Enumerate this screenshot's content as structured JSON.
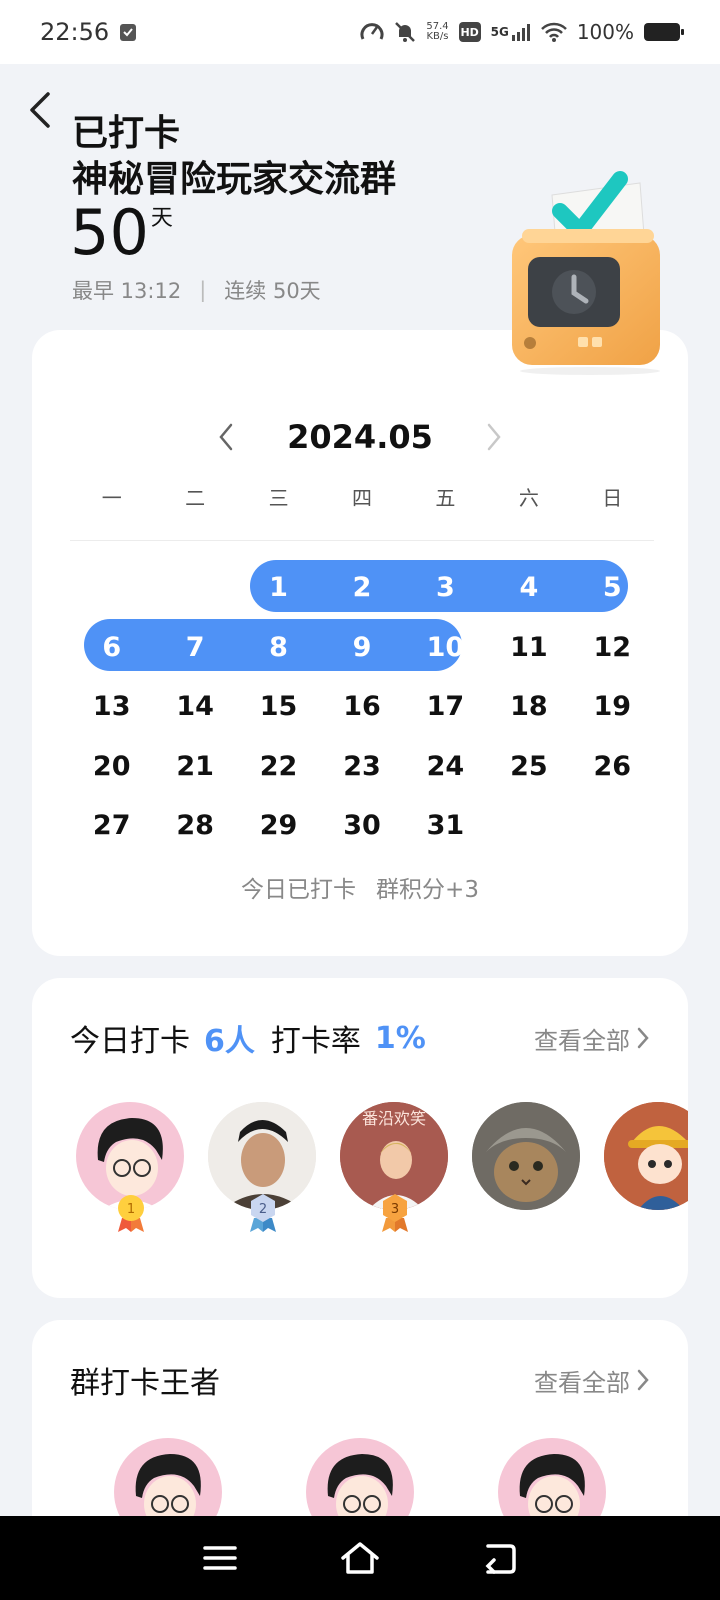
{
  "status_bar": {
    "time": "22:56",
    "net_speed_value": "57.4",
    "net_speed_unit": "KB/s",
    "hd_label": "HD",
    "network": "5G",
    "battery": "100%"
  },
  "header": {
    "status": "已打卡",
    "group_name": "神秘冒险玩家交流群",
    "days_count": "50",
    "days_unit": "天",
    "earliest": "最早 13:12",
    "separator": "|",
    "streak": "连续 50天"
  },
  "calendar": {
    "month": "2024.05",
    "weekdays": [
      "一",
      "二",
      "三",
      "四",
      "五",
      "六",
      "日"
    ],
    "checked_days": [
      1,
      2,
      3,
      4,
      5,
      6,
      7,
      8,
      9,
      10
    ],
    "rows": [
      [
        "",
        "",
        "1",
        "2",
        "3",
        "4",
        "5"
      ],
      [
        "6",
        "7",
        "8",
        "9",
        "10",
        "11",
        "12"
      ],
      [
        "13",
        "14",
        "15",
        "16",
        "17",
        "18",
        "19"
      ],
      [
        "20",
        "21",
        "22",
        "23",
        "24",
        "25",
        "26"
      ],
      [
        "27",
        "28",
        "29",
        "30",
        "31",
        "",
        ""
      ]
    ],
    "footer_status": "今日已打卡",
    "footer_points": "群积分+3",
    "accent_color": "#4f92f6"
  },
  "today": {
    "title": "今日打卡",
    "people": "6人",
    "rate_label": "打卡率",
    "rate_value": "1%",
    "view_all": "查看全部",
    "avatar_text": "番沿欢笑",
    "ranks": [
      "1",
      "2",
      "3"
    ]
  },
  "king": {
    "title": "群打卡王者",
    "view_all": "查看全部"
  }
}
